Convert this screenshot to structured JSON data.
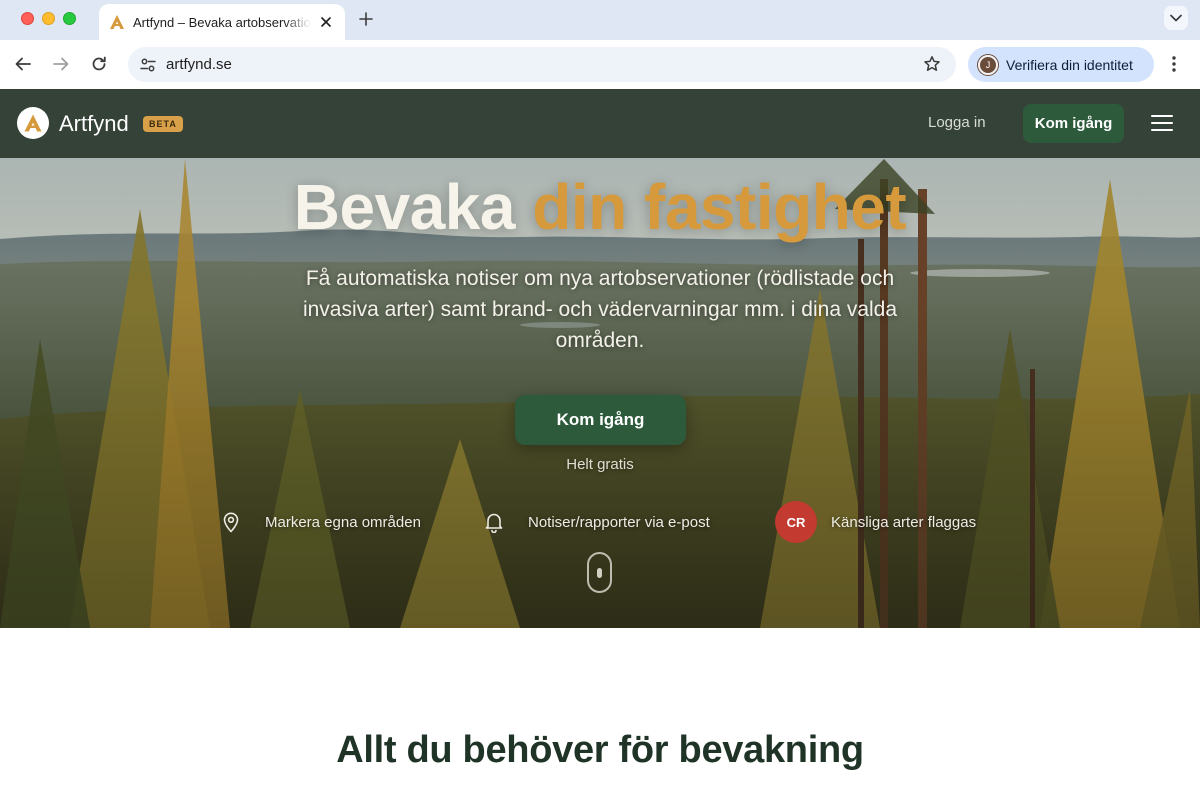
{
  "browser": {
    "tab_title": "Artfynd – Bevaka artobservationer",
    "url": "artfynd.se",
    "profile_label": "Verifiera din identitet",
    "profile_initial": "J",
    "icons": [
      "close-icon",
      "plus-icon",
      "chevron-down-icon",
      "back-arrow-icon",
      "forward-arrow-icon",
      "reload-icon",
      "site-settings-icon",
      "star-icon",
      "kebab-menu-icon"
    ]
  },
  "site_nav": {
    "brand": "Artfynd",
    "badge": "BETA",
    "login": "Logga in",
    "cta": "Kom igång"
  },
  "hero": {
    "title_part1": "Bevaka",
    "title_part2": "din fastighet",
    "subtitle": "Få automatiska notiser om nya artobservationer (rödlistade och invasiva arter) samt brand- och vädervarningar mm. i dina valda områden.",
    "cta": "Kom igång",
    "note": "Helt gratis",
    "features": [
      {
        "icon": "map-pin-icon",
        "label": "Markera egna områden"
      },
      {
        "icon": "bell-icon",
        "label": "Notiser/rapporter via e-post"
      },
      {
        "icon": "cr-badge",
        "badge_text": "CR",
        "label": "Känsliga arter flaggas"
      }
    ]
  },
  "section": {
    "title": "Allt du behöver för bevakning"
  },
  "colors": {
    "brand_green": "#2e5a3c",
    "accent_gold": "#d69a3d",
    "nav_bg": "#2b382d",
    "critical_red": "#c23a30"
  }
}
